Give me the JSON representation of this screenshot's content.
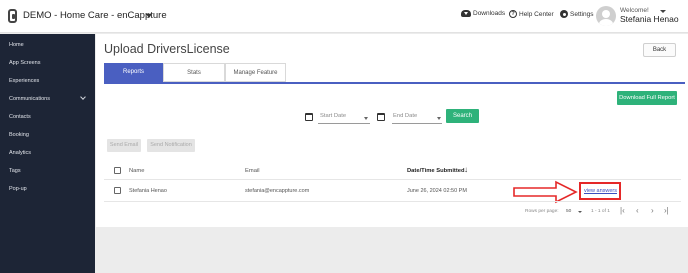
{
  "header": {
    "app_title": "DEMO - Home Care - enCappture",
    "downloads_label": "Downloads",
    "help_label": "Help Center",
    "settings_label": "Settings",
    "welcome_text": "Welcome!",
    "user_name": "Stefania Henao"
  },
  "sidebar": {
    "items": [
      {
        "label": "Home"
      },
      {
        "label": "App Screens"
      },
      {
        "label": "Experiences"
      },
      {
        "label": "Communications"
      },
      {
        "label": "Contacts"
      },
      {
        "label": "Booking"
      },
      {
        "label": "Analytics"
      },
      {
        "label": "Tags"
      },
      {
        "label": "Pop-up"
      }
    ]
  },
  "main": {
    "title": "Upload DriversLicense",
    "back_label": "Back",
    "tabs": [
      {
        "label": "Reports",
        "active": true
      },
      {
        "label": "Stats",
        "active": false
      },
      {
        "label": "Manage Feature",
        "active": false
      }
    ],
    "download_report_label": "Download Full Report",
    "start_date_placeholder": "Start Date",
    "end_date_placeholder": "End Date",
    "search_label": "Search",
    "send_email_label": "Send Email",
    "send_notification_label": "Send Notification",
    "table": {
      "columns": [
        "Name",
        "Email",
        "Date/Time Submitted"
      ],
      "rows": [
        {
          "name": "Stefania Henao",
          "email": "stefania@encappture.com",
          "submitted": "June 26, 2024 02:50 PM",
          "action": "view answers"
        }
      ]
    },
    "pagination": {
      "rows_per_page_label": "Rows per page:",
      "rows_per_page_value": "50",
      "range": "1 - 1 of 1"
    }
  },
  "colors": {
    "sidebar_bg": "#1d2536",
    "accent": "#4a5fc1",
    "green": "#2eb27a",
    "annotation_red": "#e52828"
  }
}
